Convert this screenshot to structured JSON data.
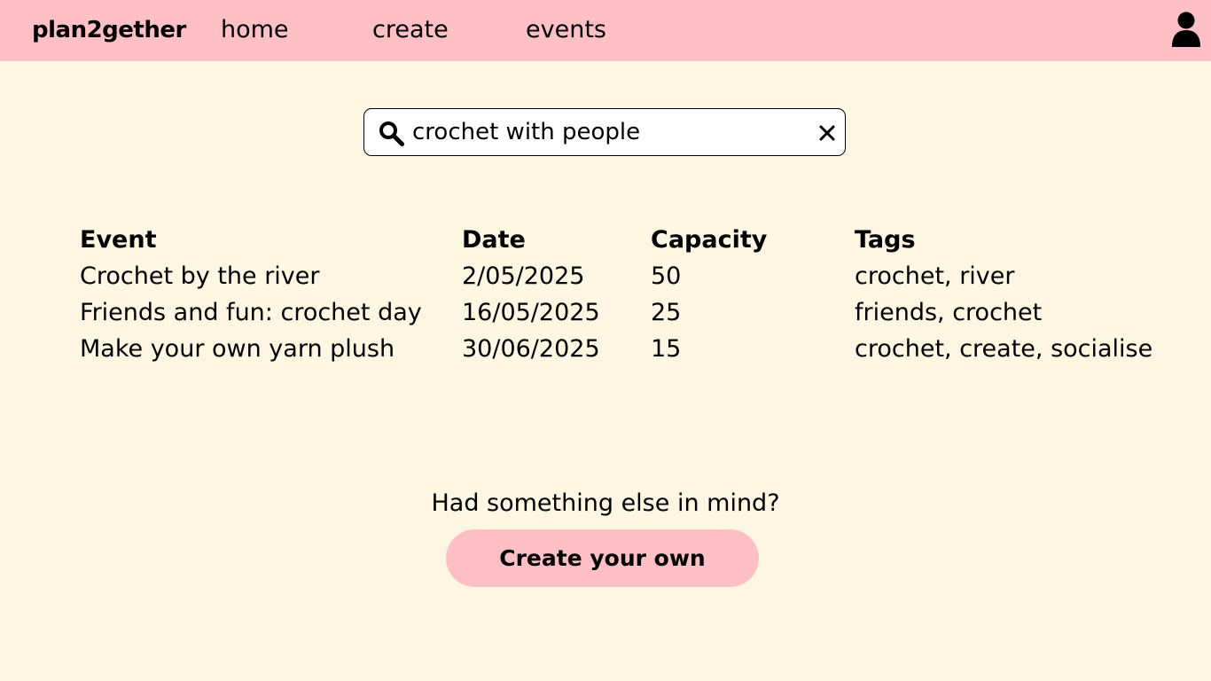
{
  "navbar": {
    "brand": "plan2gether",
    "links": [
      {
        "label": "home"
      },
      {
        "label": "create"
      },
      {
        "label": "events"
      }
    ],
    "user_icon": "user-icon"
  },
  "search": {
    "value": "crochet with people",
    "search_icon": "search-icon",
    "clear_icon": "close-icon"
  },
  "table": {
    "headers": [
      "Event",
      "Date",
      "Capacity",
      "Tags"
    ],
    "rows": [
      {
        "event": "Crochet by the river",
        "date": "2/05/2025",
        "capacity": "50",
        "tags": "crochet, river"
      },
      {
        "event": "Friends and fun: crochet day",
        "date": "16/05/2025",
        "capacity": "25",
        "tags": "friends, crochet"
      },
      {
        "event": "Make your own yarn plush",
        "date": "30/06/2025",
        "capacity": "15",
        "tags": "crochet, create, socialise"
      }
    ]
  },
  "cta": {
    "prompt": "Had something else in mind?",
    "button_label": "Create your own"
  },
  "colors": {
    "navbar_bg": "#fec0c4",
    "page_bg": "#fdf6e3",
    "button_bg": "#fec0c4"
  }
}
